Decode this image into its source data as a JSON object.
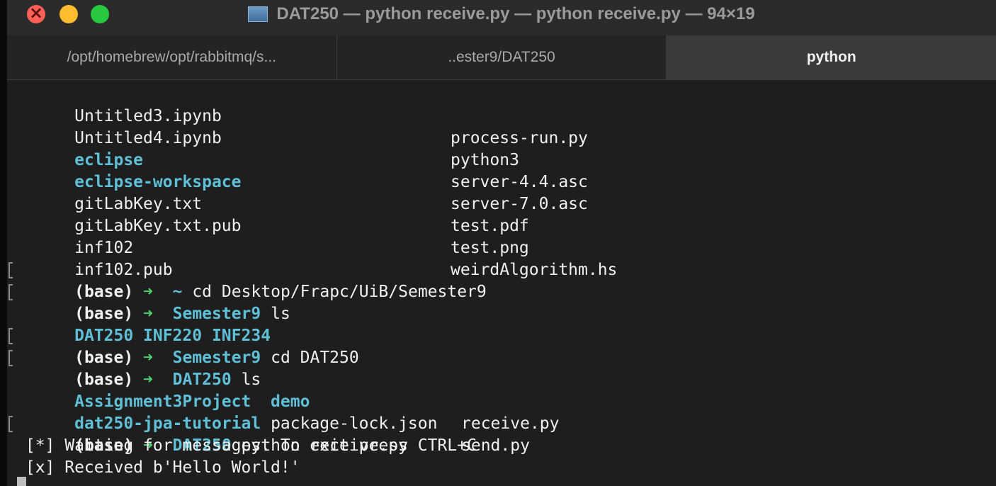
{
  "window": {
    "title": "DAT250 — python receive.py — python receive.py — 94×19",
    "title_icon": "terminal-folder-icon"
  },
  "tabs": [
    {
      "label": "/opt/homebrew/opt/rabbitmq/s...",
      "active": false
    },
    {
      "label": "..ester9/DAT250",
      "active": false
    },
    {
      "label": "python",
      "active": true
    }
  ],
  "colors": {
    "directory": "#5fbfd6",
    "prompt_arrow": "#4fd06a",
    "text": "#f0f0f0",
    "background": "#1e1e1e",
    "close": "#fe5f57",
    "minimize": "#febc2e",
    "zoom": "#28c840"
  },
  "listing": [
    {
      "left": "Untitled3.ipynb",
      "left_is_dir": false,
      "right": "process-run.py"
    },
    {
      "left": "Untitled4.ipynb",
      "left_is_dir": false,
      "right": "python3"
    },
    {
      "left": "eclipse",
      "left_is_dir": true,
      "right": "server-4.4.asc"
    },
    {
      "left": "eclipse-workspace",
      "left_is_dir": true,
      "right": "server-7.0.asc"
    },
    {
      "left": "gitLabKey.txt",
      "left_is_dir": false,
      "right": "test.pdf"
    },
    {
      "left": "gitLabKey.txt.pub",
      "left_is_dir": false,
      "right": "test.png"
    },
    {
      "left": "inf102",
      "left_is_dir": false,
      "right": "weirdAlgorithm.hs"
    },
    {
      "left": "inf102.pub",
      "left_is_dir": false,
      "right": ""
    }
  ],
  "prompts": [
    {
      "env": "(base)",
      "arrow": "➜",
      "cwd": "~",
      "command": "cd Desktop/Frapc/UiB/Semester9"
    },
    {
      "env": "(base)",
      "arrow": "➜",
      "cwd": "Semester9",
      "command": "ls"
    },
    {
      "env": "(base)",
      "arrow": "➜",
      "cwd": "Semester9",
      "command": "cd DAT250"
    },
    {
      "env": "(base)",
      "arrow": "➜",
      "cwd": "DAT250",
      "command": "ls"
    },
    {
      "env": "(base)",
      "arrow": "➜",
      "cwd": "DAT250",
      "command": "python receive.py"
    }
  ],
  "semester_ls": "DAT250 INF220 INF234",
  "dat250_ls": [
    {
      "a": "Assignment3Project",
      "b": "demo",
      "b_is_dir": true,
      "c": "receive.py"
    },
    {
      "a": "dat250-jpa-tutorial",
      "b": "package-lock.json",
      "b_is_dir": false,
      "c": "send.py"
    }
  ],
  "output": [
    " [*] Waiting for messages. To exit press CTRL+C",
    " [x] Received b'Hello World!'"
  ]
}
